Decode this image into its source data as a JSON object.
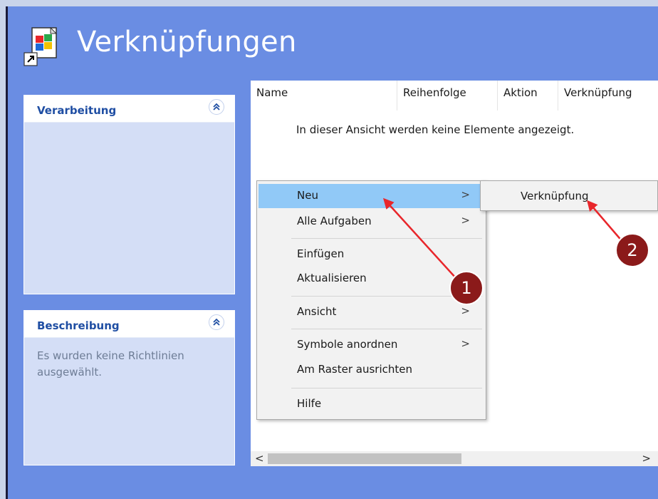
{
  "header": {
    "title": "Verknüpfungen",
    "icon": "shortcut-policy-icon"
  },
  "panels": {
    "verarbeitung": {
      "title": "Verarbeitung",
      "collapse_icon": "double-chevron-up-icon"
    },
    "beschreibung": {
      "title": "Beschreibung",
      "text": "Es wurden keine Richtlinien ausgewählt.",
      "collapse_icon": "double-chevron-up-icon"
    }
  },
  "listview": {
    "columns": [
      "Name",
      "Reihenfolge",
      "Aktion",
      "Verknüpfung"
    ],
    "empty_message": "In dieser Ansicht werden keine Elemente angezeigt.",
    "scroll_left": "<",
    "scroll_right": ">"
  },
  "context_menu": {
    "items": [
      {
        "label": "Neu",
        "submenu": true,
        "highlighted": true,
        "arrow": ">"
      },
      {
        "label": "Alle Aufgaben",
        "submenu": true,
        "arrow": ">"
      },
      {
        "label": "Einfügen"
      },
      {
        "label": "Aktualisieren"
      },
      {
        "label": "Ansicht",
        "submenu": true,
        "arrow": ">"
      },
      {
        "label": "Symbole anordnen",
        "submenu": true,
        "arrow": ">"
      },
      {
        "label": "Am Raster ausrichten"
      },
      {
        "label": "Hilfe"
      }
    ]
  },
  "submenu": {
    "items": [
      {
        "label": "Verknüpfung"
      }
    ]
  },
  "annotations": {
    "badge1": "1",
    "badge2": "2"
  },
  "colors": {
    "background": "#6a8de3",
    "panel_title": "#1f4ea3",
    "highlight": "#91c9f7",
    "annotation": "#8b1a1a",
    "arrow": "#e8262b"
  }
}
